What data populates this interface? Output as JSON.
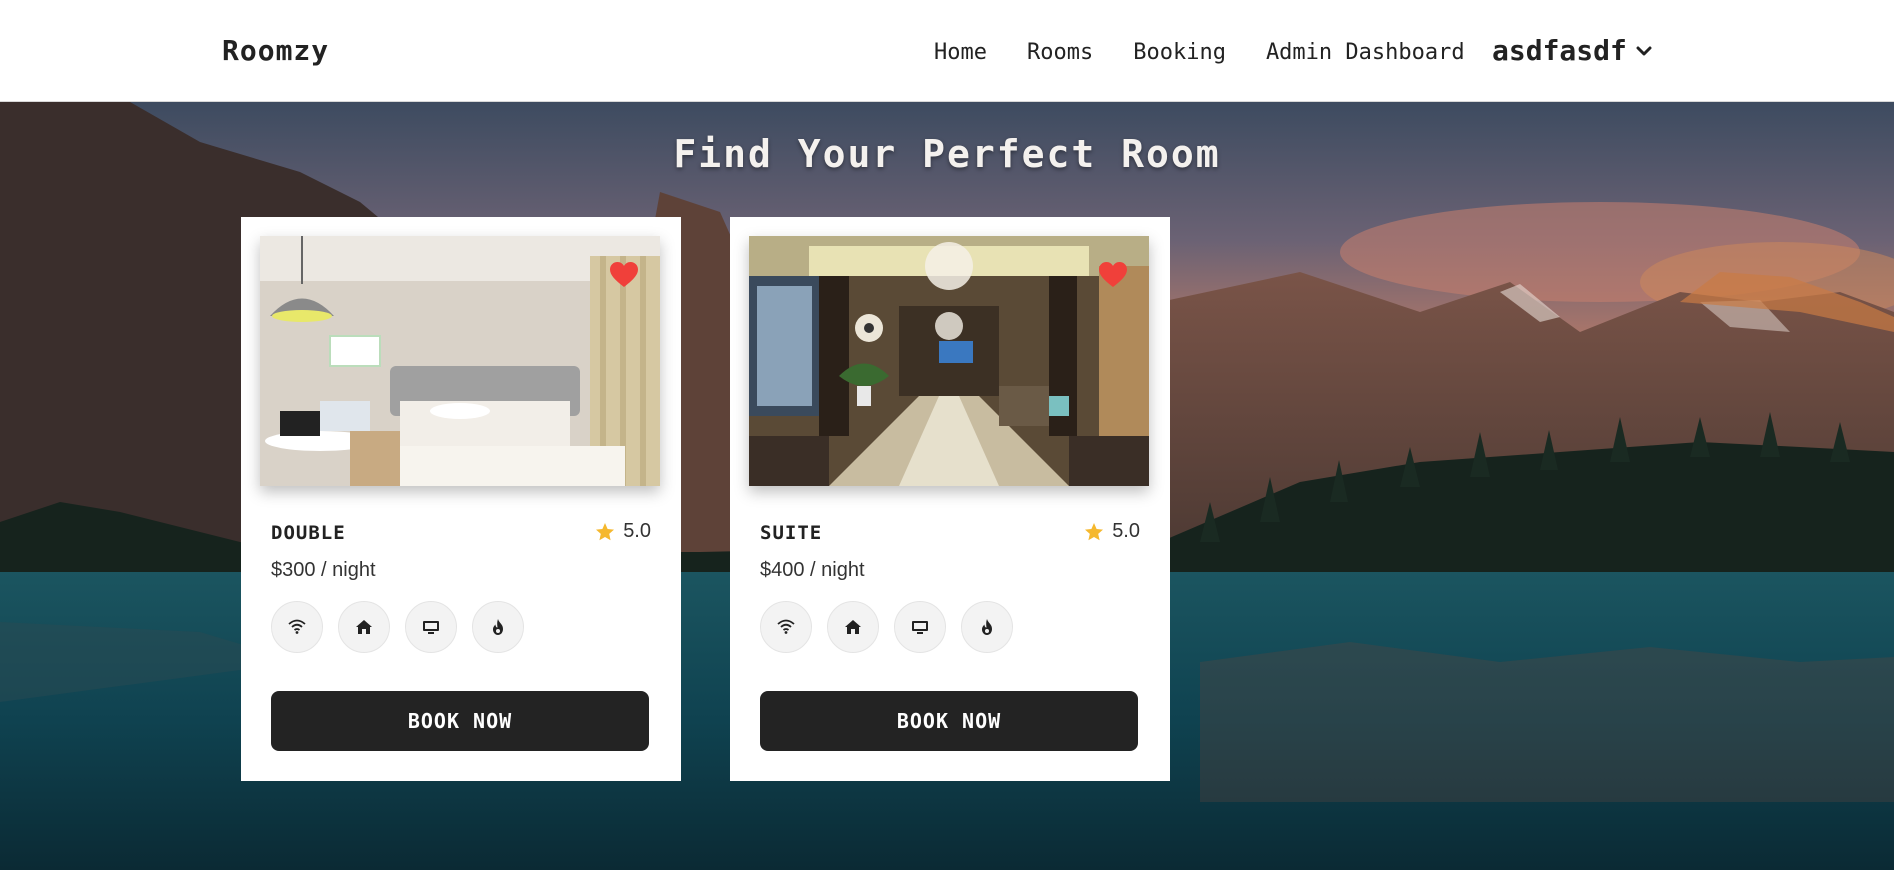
{
  "navbar": {
    "brand": "Roomzy",
    "links": [
      "Home",
      "Rooms",
      "Booking",
      "Admin Dashboard"
    ],
    "user": "asdfasdf"
  },
  "hero": {
    "title": "Find Your Perfect Room"
  },
  "rooms": [
    {
      "type": "DOUBLE",
      "rating": "5.0",
      "price": "$300 / night",
      "book_label": "BOOK NOW",
      "favorited": true,
      "amenities": [
        "wifi-icon",
        "home-icon",
        "tv-icon",
        "flame-icon"
      ]
    },
    {
      "type": "SUITE",
      "rating": "5.0",
      "price": "$400 / night",
      "book_label": "BOOK NOW",
      "favorited": true,
      "amenities": [
        "wifi-icon",
        "home-icon",
        "tv-icon",
        "flame-icon"
      ]
    }
  ],
  "colors": {
    "heart": "#f0403a",
    "star": "#f5b82e",
    "button": "#232323"
  }
}
